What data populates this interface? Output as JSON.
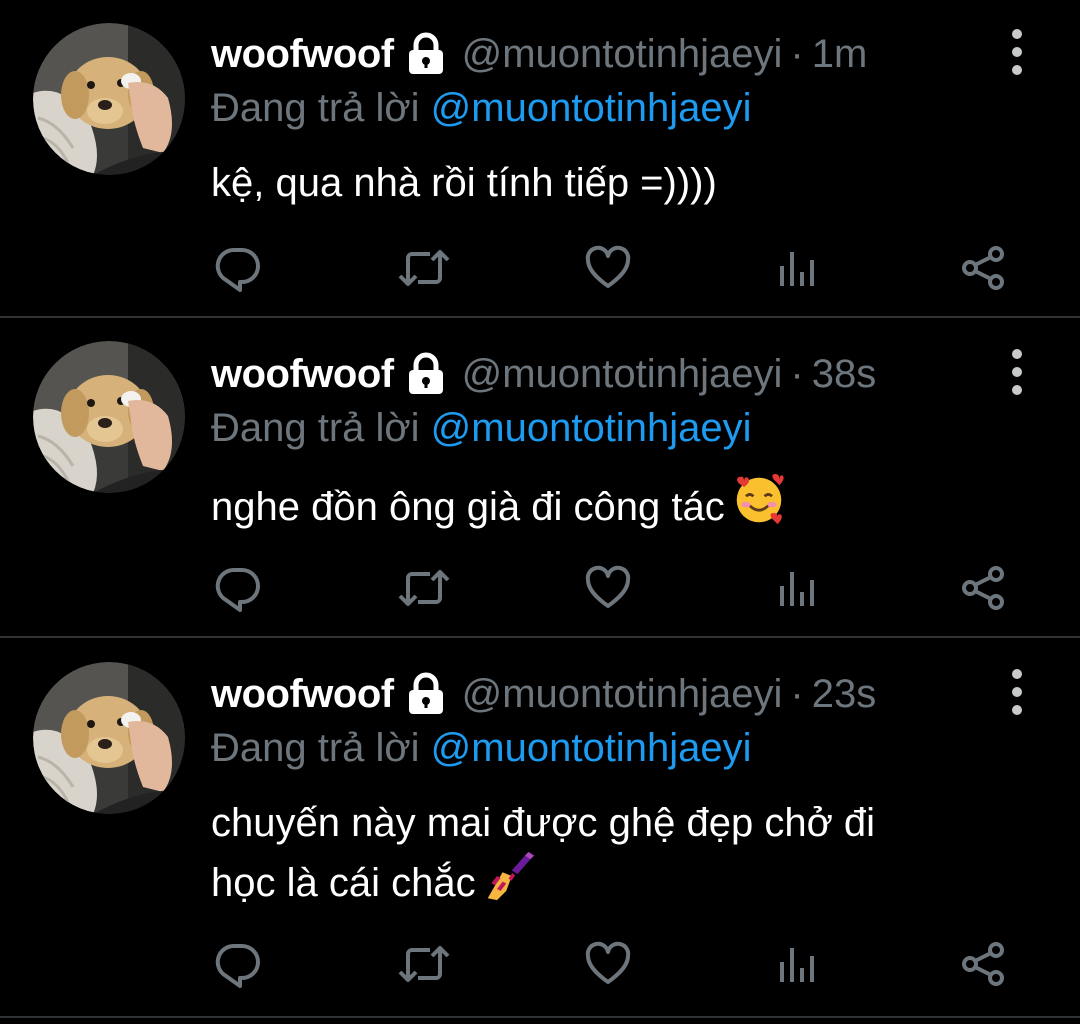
{
  "colors": {
    "background": "#000000",
    "text": "#ffffff",
    "muted": "#6e767d",
    "link": "#1d9bf0",
    "divider": "#2f3336"
  },
  "tweets": [
    {
      "display_name": "woofwoof",
      "handle": "@muontotinhjaeyi",
      "separator": "·",
      "time": "1m",
      "reply_prefix": "Đang trả lời",
      "reply_to": "@muontotinhjaeyi",
      "text_lines": [
        "kệ, qua nhà rồi tính tiếp =))))"
      ],
      "emoji": ""
    },
    {
      "display_name": "woofwoof",
      "handle": "@muontotinhjaeyi",
      "separator": "·",
      "time": "38s",
      "reply_prefix": "Đang trả lời",
      "reply_to": "@muontotinhjaeyi",
      "text_lines": [
        "nghe đồn ông già đi công tác"
      ],
      "emoji": "smiling-face-with-hearts-emoji"
    },
    {
      "display_name": "woofwoof",
      "handle": "@muontotinhjaeyi",
      "separator": "·",
      "time": "23s",
      "reply_prefix": "Đang trả lời",
      "reply_to": "@muontotinhjaeyi",
      "text_lines": [
        "chuyến này mai được ghệ đẹp chở đi",
        "học là cái chắc"
      ],
      "emoji": "nail-polish-emoji"
    }
  ],
  "icons": {
    "lock": "lock-icon",
    "more": "more-vertical-icon",
    "reply": "reply-icon",
    "retweet": "retweet-icon",
    "like": "heart-icon",
    "analytics": "analytics-icon",
    "share": "share-icon"
  }
}
